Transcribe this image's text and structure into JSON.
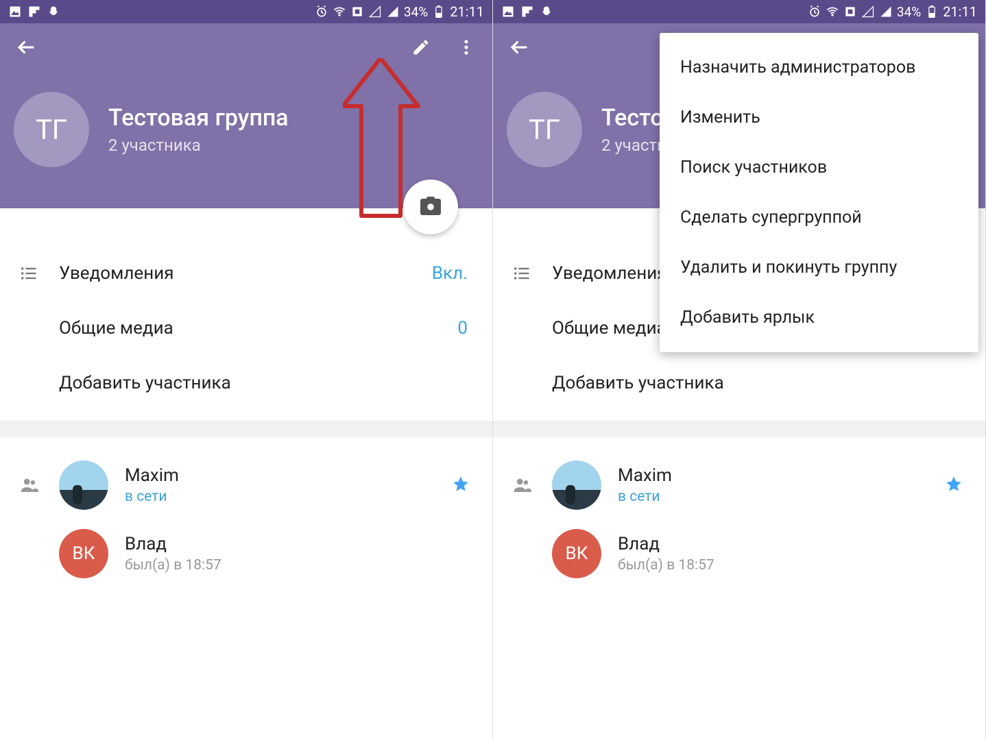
{
  "status": {
    "battery": "34%",
    "time": "21:11"
  },
  "group": {
    "avatar_initials": "ТГ",
    "title": "Тестовая группа",
    "subtitle": "2 участника"
  },
  "settings": {
    "notifications_label": "Уведомления",
    "notifications_value": "Вкл.",
    "shared_media_label": "Общие медиа",
    "shared_media_value": "0",
    "add_member_label": "Добавить участника"
  },
  "members": [
    {
      "name": "Maxim",
      "status": "в сети",
      "online": true,
      "starred": true,
      "avatar_text": ""
    },
    {
      "name": "Влад",
      "status": "был(а) в 18:57",
      "online": false,
      "starred": false,
      "avatar_text": "ВК"
    }
  ],
  "menu": {
    "items": [
      "Назначить администраторов",
      "Изменить",
      "Поиск участников",
      "Сделать супергруппой",
      "Удалить и покинуть группу",
      "Добавить ярлык"
    ]
  }
}
